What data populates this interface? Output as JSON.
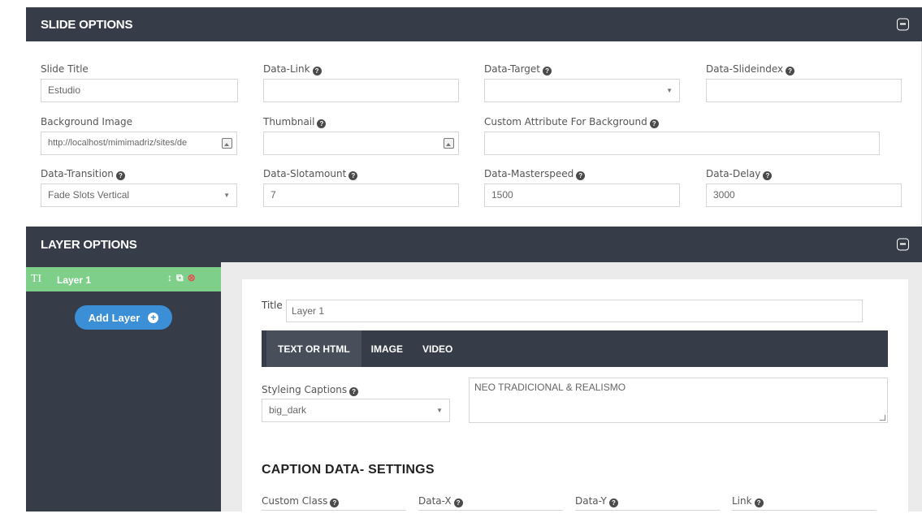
{
  "slide_options": {
    "title": "SLIDE OPTIONS",
    "fields": {
      "slide_title": {
        "label": "Slide Title",
        "value": "Estudio"
      },
      "data_link": {
        "label": "Data-Link",
        "value": ""
      },
      "data_target": {
        "label": "Data-Target",
        "value": ""
      },
      "data_slideindex": {
        "label": "Data-Slideindex",
        "value": ""
      },
      "background_image": {
        "label": "Background Image",
        "value": "http://localhost/mimimadriz/sites/de"
      },
      "thumbnail": {
        "label": "Thumbnail",
        "value": ""
      },
      "custom_attribute": {
        "label": "Custom Attribute For Background",
        "value": ""
      },
      "data_transition": {
        "label": "Data-Transition",
        "value": "Fade Slots Vertical"
      },
      "data_slotamount": {
        "label": "Data-Slotamount",
        "value": "7"
      },
      "data_masterspeed": {
        "label": "Data-Masterspeed",
        "value": "1500"
      },
      "data_delay": {
        "label": "Data-Delay",
        "value": "3000"
      }
    }
  },
  "layer_options": {
    "title": "LAYER OPTIONS",
    "layers": [
      {
        "icon": "TI",
        "name": "Layer 1"
      }
    ],
    "add_layer_label": "Add Layer",
    "editor": {
      "title_label": "Title",
      "title_value": "Layer 1",
      "tabs": [
        "TEXT OR HTML",
        "IMAGE",
        "VIDEO"
      ],
      "active_tab": "TEXT OR HTML",
      "caption_style_label": "Styleing Captions",
      "caption_style_value": "big_dark",
      "caption_text": "NEO TRADICIONAL & REALISMO",
      "section_heading": "CAPTION DATA- SETTINGS",
      "bottom_labels": [
        "Custom Class",
        "Data-X",
        "Data-Y",
        "Link"
      ]
    }
  },
  "colors": {
    "header_bg": "#373d48",
    "layer_active": "#7ecf8a",
    "add_button": "#3b8fd6"
  }
}
